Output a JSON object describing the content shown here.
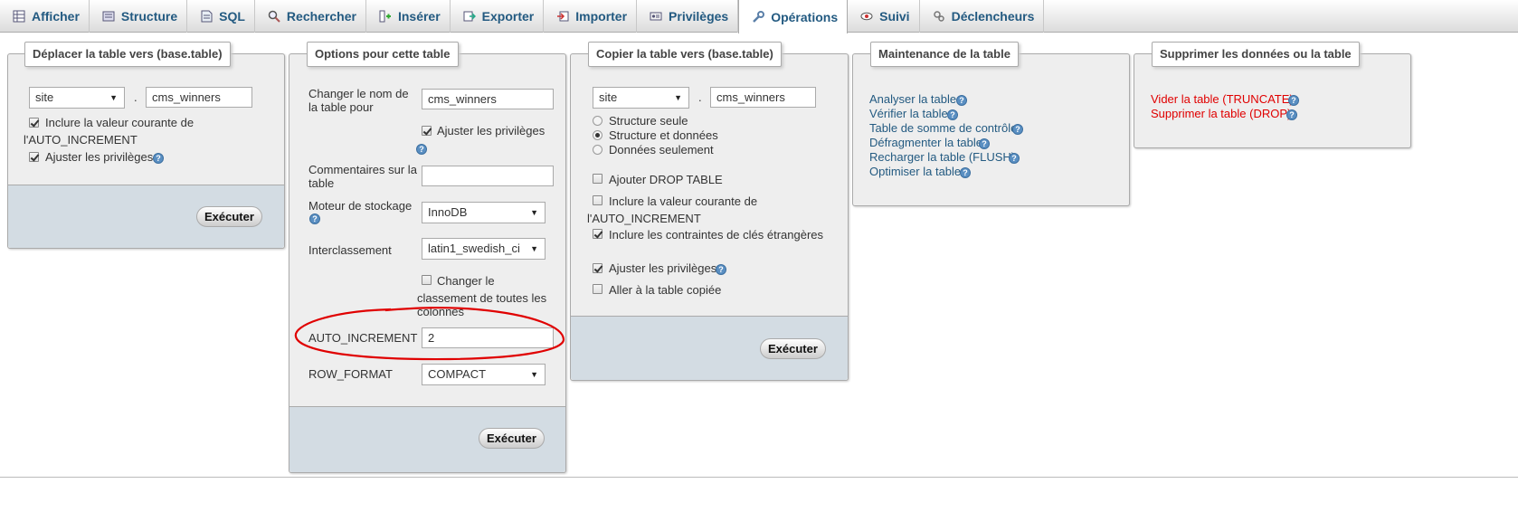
{
  "tabs": [
    {
      "label": "Afficher",
      "icon": "table-icon"
    },
    {
      "label": "Structure",
      "icon": "structure-icon"
    },
    {
      "label": "SQL",
      "icon": "sql-icon"
    },
    {
      "label": "Rechercher",
      "icon": "search-icon"
    },
    {
      "label": "Insérer",
      "icon": "insert-icon"
    },
    {
      "label": "Exporter",
      "icon": "export-icon"
    },
    {
      "label": "Importer",
      "icon": "import-icon"
    },
    {
      "label": "Privilèges",
      "icon": "privileges-icon"
    },
    {
      "label": "Opérations",
      "icon": "wrench-icon",
      "active": true
    },
    {
      "label": "Suivi",
      "icon": "eye-icon"
    },
    {
      "label": "Déclencheurs",
      "icon": "triggers-icon"
    }
  ],
  "move": {
    "legend": "Déplacer la table vers (base.table)",
    "db_select": "site",
    "dot": ".",
    "table_value": "cms_winners",
    "include_ai_label_1": "Inclure la valeur courante de",
    "include_ai_label_2": "l'AUTO_INCREMENT",
    "adjust_priv_label": "Ajuster les privilèges",
    "execute": "Exécuter"
  },
  "options": {
    "legend": "Options pour cette table",
    "rename_label": "Changer le nom de la table pour",
    "rename_value": "cms_winners",
    "adjust_priv_label": "Ajuster les privilèges",
    "comments_label": "Commentaires sur la table",
    "comments_value": "",
    "engine_label": "Moteur de stockage",
    "engine_value": "InnoDB",
    "collation_label": "Interclassement",
    "collation_value": "latin1_swedish_ci",
    "change_all_label_1": "Changer le",
    "change_all_label_2": "classement de toutes les",
    "change_all_label_3": "colonnes",
    "auto_increment_label": "AUTO_INCREMENT",
    "auto_increment_value": "2",
    "row_format_label": "ROW_FORMAT",
    "row_format_value": "COMPACT",
    "execute": "Exécuter"
  },
  "copy": {
    "legend": "Copier la table vers (base.table)",
    "db_select": "site",
    "dot": ".",
    "table_value": "cms_winners",
    "radio_structure": "Structure seule",
    "radio_both": "Structure et données",
    "radio_data": "Données seulement",
    "drop_table": "Ajouter DROP TABLE",
    "include_ai_label_1": "Inclure la valeur courante de",
    "include_ai_label_2": "l'AUTO_INCREMENT",
    "foreign_keys": "Inclure les contraintes de clés étrangères",
    "adjust_priv_label": "Ajuster les privilèges",
    "goto_copied": "Aller à la table copiée",
    "execute": "Exécuter"
  },
  "maintenance": {
    "legend": "Maintenance de la table",
    "links": [
      "Analyser la table",
      "Vérifier la table",
      "Table de somme de contrôle",
      "Défragmenter la table",
      "Recharger la table (FLUSH)",
      "Optimiser la table"
    ]
  },
  "delete": {
    "legend": "Supprimer les données ou la table",
    "links": [
      "Vider la table (TRUNCATE)",
      "Supprimer la table (DROP)"
    ]
  },
  "colors": {
    "tab_text": "#235a81",
    "link": "#235a81",
    "danger": "#e00000",
    "panel_bg": "#eeeeee",
    "footer_bg": "#d3dce3",
    "annotation": "#e00000"
  }
}
